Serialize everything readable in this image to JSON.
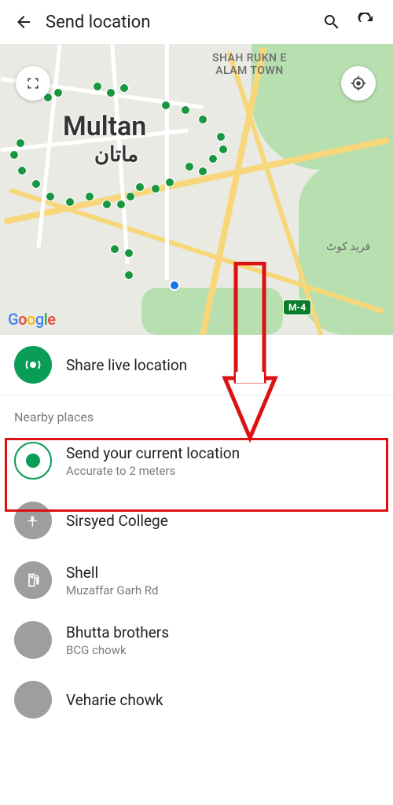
{
  "header": {
    "title": "Send location"
  },
  "map": {
    "city_name": "Multan",
    "city_name_native": "ماتان",
    "area_top_l1": "SHAH RUKN E",
    "area_top_l2": "ALAM TOWN",
    "area_side": "فرید کوٹ",
    "highway": "M-4",
    "attribution": "Google"
  },
  "share_live": {
    "title": "Share live location"
  },
  "section_nearby": "Nearby places",
  "current_loc": {
    "title": "Send your current location",
    "subtitle": "Accurate to 2 meters"
  },
  "places": [
    {
      "title": "Sirsyed College",
      "subtitle": ""
    },
    {
      "title": "Shell",
      "subtitle": "Muzaffar Garh Rd"
    },
    {
      "title": "Bhutta brothers",
      "subtitle": "BCG chowk"
    },
    {
      "title": "Veharie chowk",
      "subtitle": ""
    }
  ]
}
